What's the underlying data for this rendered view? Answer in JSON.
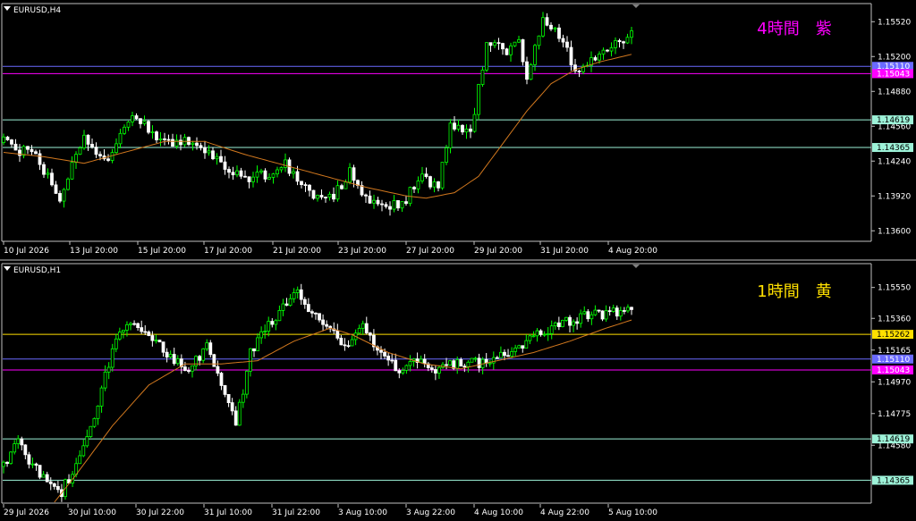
{
  "colors": {
    "background": "#000000",
    "frame": "#c0c0c0",
    "bull_candle": "#00ff00",
    "bear_candle": "#ffffff",
    "moving_average": "#d2781e",
    "h4_label": "#ff00ff",
    "h1_label": "#ffe000",
    "line_blue": "#6a6aff",
    "line_magenta": "#ff00ff",
    "line_green": "#9df2d8",
    "line_yellow": "#ffe000"
  },
  "chart_data": [
    {
      "type": "candlestick",
      "symbol_label": "EURUSD,H4",
      "annotation": "4時間　紫",
      "ylim": [
        1.1352,
        1.1567
      ],
      "y_ticks": [
        "1.15520",
        "1.15200",
        "1.14880",
        "1.14560",
        "1.14240",
        "1.13920",
        "1.13600"
      ],
      "x_ticks": [
        "10 Jul 2026",
        "13 Jul 20:00",
        "15 Jul 20:00",
        "17 Jul 20:00",
        "21 Jul 20:00",
        "23 Jul 20:00",
        "27 Jul 20:00",
        "29 Jul 20:00",
        "31 Jul 20:00",
        "4 Aug 20:00"
      ],
      "price_lines": [
        {
          "label": "1.15110",
          "value": 1.1511,
          "color": "#6a6aff",
          "text_color": "#ffffff"
        },
        {
          "label": "1.15043",
          "value": 1.15043,
          "color": "#ff00ff",
          "text_color": "#ffffff"
        },
        {
          "label": "1.14619",
          "value": 1.14619,
          "color": "#9df2d8",
          "text_color": "#000000"
        },
        {
          "label": "1.14365",
          "value": 1.14365,
          "color": "#9df2d8",
          "text_color": "#000000"
        }
      ],
      "anchors": [
        [
          0,
          1.1441
        ],
        [
          8,
          1.1428
        ],
        [
          14,
          1.139
        ],
        [
          20,
          1.1445
        ],
        [
          26,
          1.142
        ],
        [
          32,
          1.147
        ],
        [
          36,
          1.1452
        ],
        [
          42,
          1.144
        ],
        [
          48,
          1.1443
        ],
        [
          54,
          1.142
        ],
        [
          62,
          1.1408
        ],
        [
          70,
          1.142
        ],
        [
          76,
          1.1395
        ],
        [
          82,
          1.1392
        ],
        [
          86,
          1.1415
        ],
        [
          90,
          1.1392
        ],
        [
          96,
          1.1382
        ],
        [
          100,
          1.139
        ],
        [
          104,
          1.141
        ],
        [
          108,
          1.1398
        ],
        [
          111,
          1.146
        ],
        [
          116,
          1.145
        ],
        [
          120,
          1.153
        ],
        [
          125,
          1.1525
        ],
        [
          128,
          1.1535
        ],
        [
          130,
          1.15
        ],
        [
          134,
          1.1555
        ],
        [
          138,
          1.154
        ],
        [
          142,
          1.151
        ],
        [
          146,
          1.1515
        ],
        [
          150,
          1.1525
        ],
        [
          154,
          1.1535
        ],
        [
          156,
          1.1548
        ]
      ],
      "ma_anchors": [
        [
          0,
          1.1432
        ],
        [
          10,
          1.1428
        ],
        [
          20,
          1.1422
        ],
        [
          30,
          1.1432
        ],
        [
          40,
          1.1442
        ],
        [
          50,
          1.1442
        ],
        [
          60,
          1.143
        ],
        [
          70,
          1.142
        ],
        [
          80,
          1.141
        ],
        [
          90,
          1.14
        ],
        [
          100,
          1.1392
        ],
        [
          105,
          1.139
        ],
        [
          112,
          1.1395
        ],
        [
          118,
          1.141
        ],
        [
          124,
          1.144
        ],
        [
          130,
          1.147
        ],
        [
          136,
          1.1495
        ],
        [
          142,
          1.1508
        ],
        [
          148,
          1.1515
        ],
        [
          156,
          1.1522
        ]
      ]
    },
    {
      "type": "candlestick",
      "symbol_label": "EURUSD,H1",
      "annotation": "1時間　黄",
      "ylim": [
        1.1423,
        1.1568
      ],
      "y_ticks": [
        "1.15550",
        "1.15360",
        "1.15165",
        "1.14970",
        "1.14775",
        "1.14580"
      ],
      "x_ticks": [
        "29 Jul 2026",
        "30 Jul 10:00",
        "30 Jul 22:00",
        "31 Jul 10:00",
        "31 Jul 22:00",
        "3 Aug 10:00",
        "3 Aug 22:00",
        "4 Aug 10:00",
        "4 Aug 22:00",
        "5 Aug 10:00"
      ],
      "price_lines": [
        {
          "label": "1.15262",
          "value": 1.15262,
          "color": "#ffe000",
          "text_color": "#000000"
        },
        {
          "label": "1.15110",
          "value": 1.1511,
          "color": "#6a6aff",
          "text_color": "#ffffff"
        },
        {
          "label": "1.15043",
          "value": 1.15043,
          "color": "#ff00ff",
          "text_color": "#ffffff"
        },
        {
          "label": "1.14619",
          "value": 1.14619,
          "color": "#9df2d8",
          "text_color": "#000000"
        },
        {
          "label": "1.14365",
          "value": 1.14365,
          "color": "#9df2d8",
          "text_color": "#000000"
        }
      ],
      "anchors": [
        [
          0,
          1.1445
        ],
        [
          4,
          1.146
        ],
        [
          10,
          1.144
        ],
        [
          16,
          1.143
        ],
        [
          20,
          1.1445
        ],
        [
          24,
          1.147
        ],
        [
          28,
          1.15
        ],
        [
          31,
          1.1525
        ],
        [
          34,
          1.1535
        ],
        [
          40,
          1.1528
        ],
        [
          45,
          1.1512
        ],
        [
          50,
          1.1505
        ],
        [
          56,
          1.1518
        ],
        [
          60,
          1.1498
        ],
        [
          64,
          1.147
        ],
        [
          68,
          1.1515
        ],
        [
          72,
          1.153
        ],
        [
          76,
          1.154
        ],
        [
          80,
          1.1555
        ],
        [
          84,
          1.154
        ],
        [
          90,
          1.153
        ],
        [
          94,
          1.1518
        ],
        [
          99,
          1.1532
        ],
        [
          104,
          1.1515
        ],
        [
          108,
          1.1505
        ],
        [
          114,
          1.1508
        ],
        [
          120,
          1.1505
        ],
        [
          126,
          1.151
        ],
        [
          132,
          1.1508
        ],
        [
          138,
          1.1515
        ],
        [
          144,
          1.1522
        ],
        [
          150,
          1.153
        ],
        [
          156,
          1.1535
        ],
        [
          162,
          1.1538
        ],
        [
          168,
          1.154
        ],
        [
          173,
          1.1545
        ]
      ],
      "ma_anchors": [
        [
          14,
          1.1423
        ],
        [
          20,
          1.144
        ],
        [
          30,
          1.147
        ],
        [
          40,
          1.1495
        ],
        [
          50,
          1.1508
        ],
        [
          60,
          1.1508
        ],
        [
          70,
          1.151
        ],
        [
          80,
          1.1522
        ],
        [
          90,
          1.153
        ],
        [
          96,
          1.1526
        ],
        [
          106,
          1.1515
        ],
        [
          116,
          1.1508
        ],
        [
          126,
          1.1505
        ],
        [
          136,
          1.151
        ],
        [
          146,
          1.1515
        ],
        [
          156,
          1.1522
        ],
        [
          166,
          1.153
        ],
        [
          173,
          1.1535
        ]
      ]
    }
  ]
}
